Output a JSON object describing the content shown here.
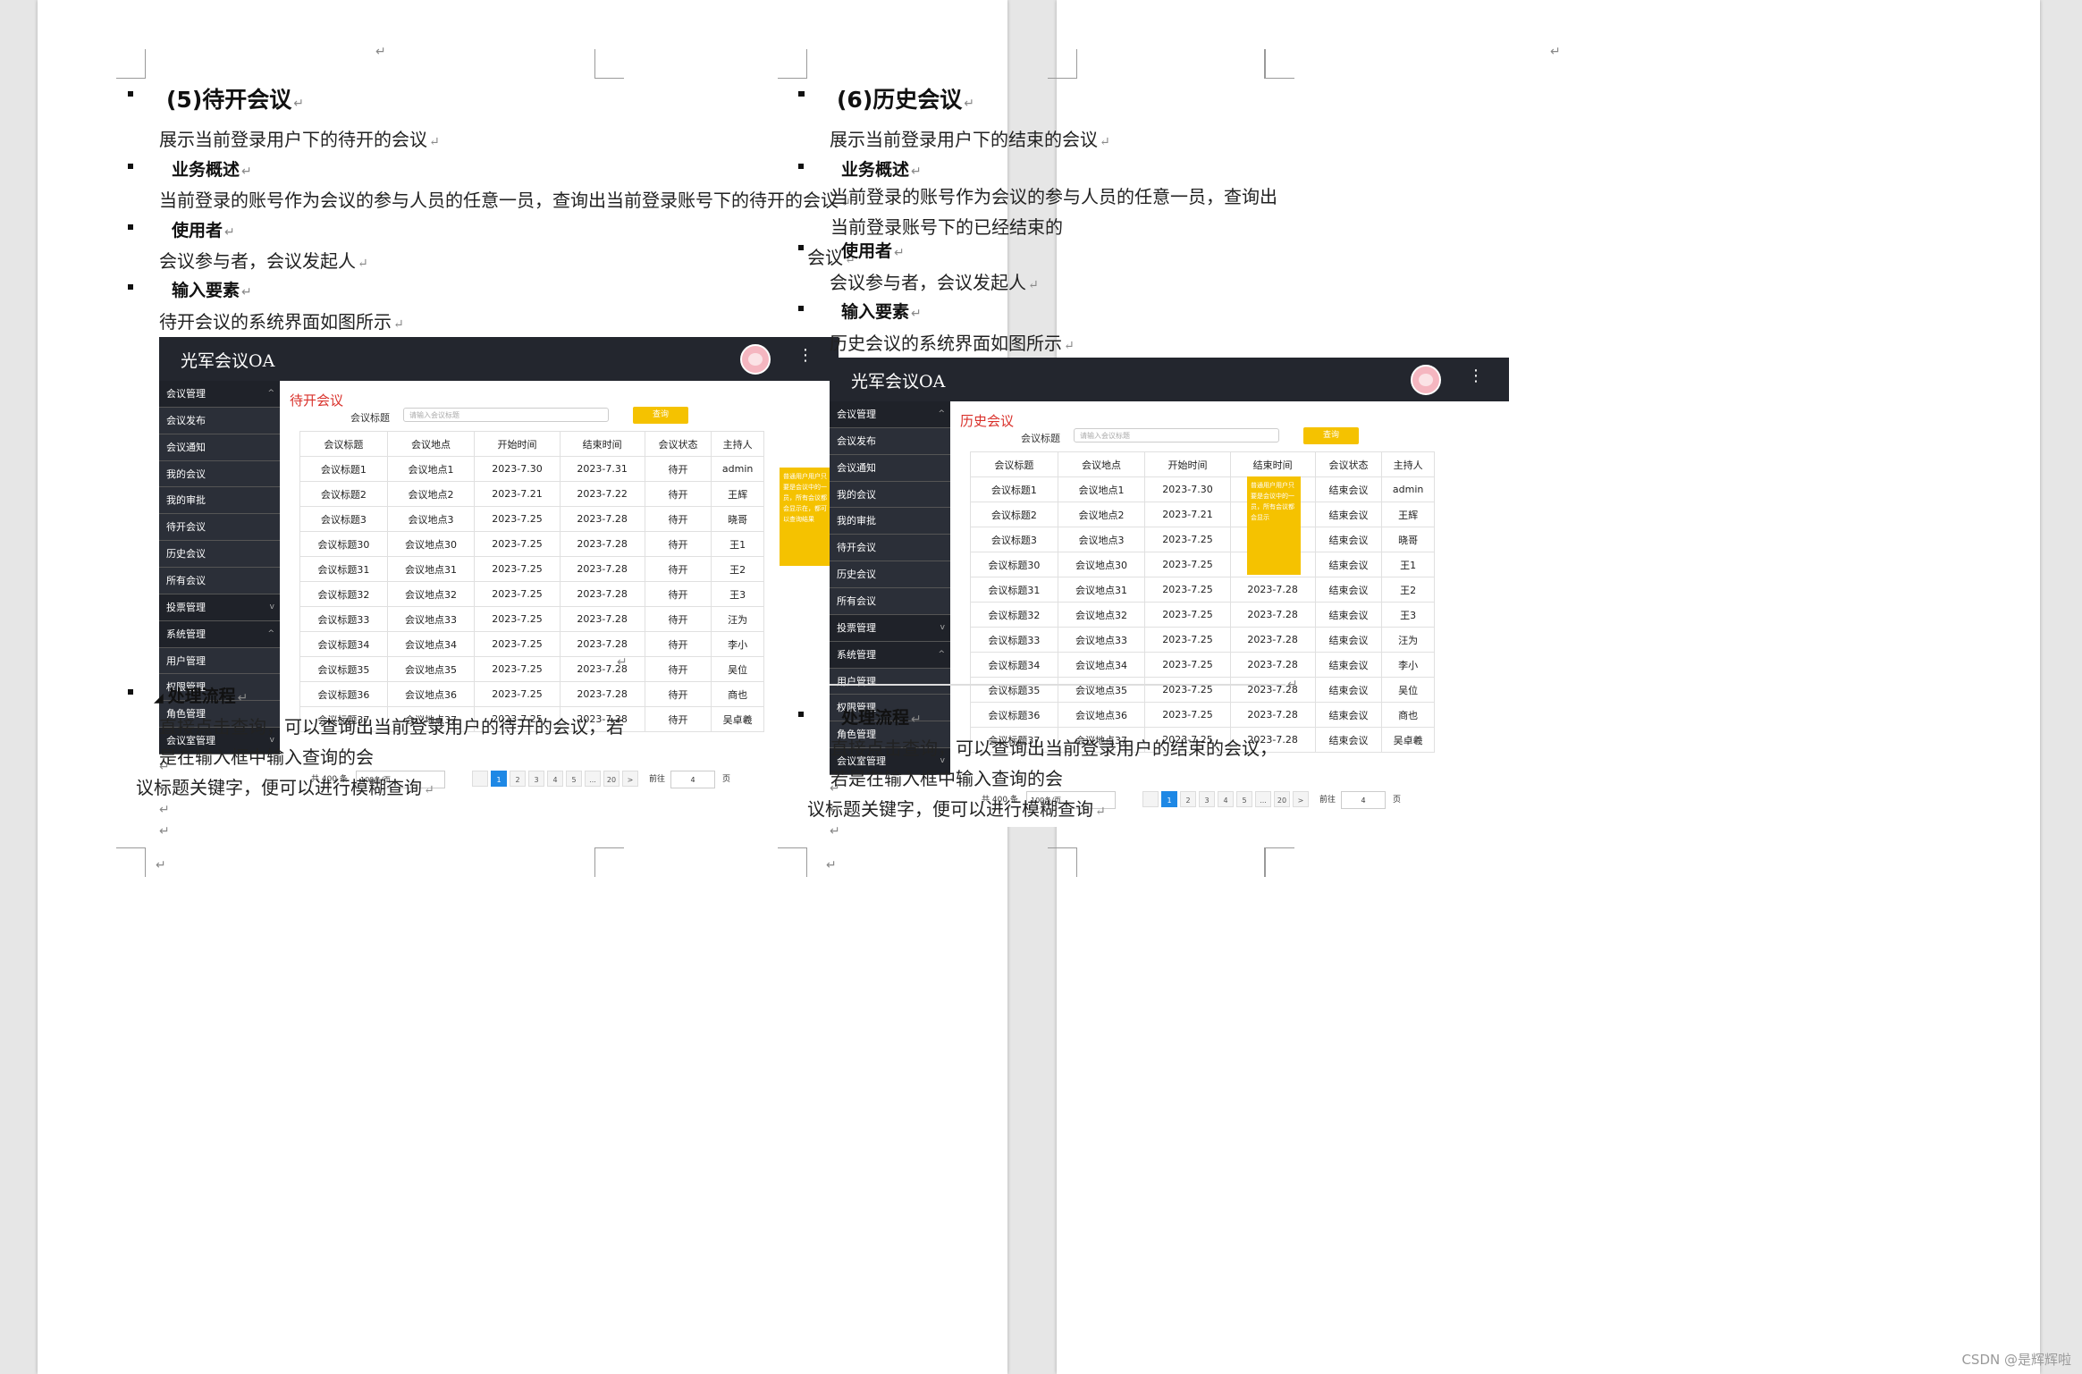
{
  "return_mark": "↵",
  "left_page": {
    "heading": "(5)待开会议",
    "intro": "展示当前登录用户下的待开的会议",
    "business_title": "业务概述",
    "business_text": "当前登录的账号作为会议的参与人员的任意一员，查询出当前登录账号下的待开的会议",
    "users_title": "使用者",
    "users_text": "会议参与者，会议发起人",
    "input_title": "输入要素",
    "input_text": "待开会议的系统界面如图所示",
    "flow_title": "处理流程",
    "flow_text_line1": "直接点击查询，可以查询出当前登录用户的待开的会议，若是在输入框中输入查询的会",
    "flow_text_line2": "议标题关键字，便可以进行模糊查询",
    "app": {
      "page_title": "待开会议",
      "notice": "普通用户用户只要是会议中的一员，所有会议都会显示在，都可以查询结果"
    },
    "status_value": "待开"
  },
  "right_page": {
    "heading": "(6)历史会议",
    "intro": "展示当前登录用户下的结束的会议",
    "business_title": "业务概述",
    "business_text_line1": "当前登录的账号作为会议的参与人员的任意一员，查询出当前登录账号下的已经结束的",
    "business_text_line2": "会议",
    "users_title": "使用者",
    "users_text": "会议参与者，会议发起人",
    "input_title": "输入要素",
    "input_text": "历史会议的系统界面如图所示",
    "flow_title": "处理流程",
    "flow_text_line1": "直接点击查询，可以查询出当前登录用户的结束的会议，若是在输入框中输入查询的会",
    "flow_text_line2": "议标题关键字，便可以进行模糊查询",
    "app": {
      "page_title": "历史会议",
      "notice": "普通用户用户只要是会议中的一员，所有会议都会显示"
    },
    "status_value": "结束会议"
  },
  "app_common": {
    "app_name": "光军会议OA",
    "kebab": "⋮",
    "sidebar": [
      {
        "label": "会议管理",
        "group": true,
        "chev": "^"
      },
      {
        "label": "会议发布"
      },
      {
        "label": "会议通知"
      },
      {
        "label": "我的会议"
      },
      {
        "label": "我的审批"
      },
      {
        "label": "待开会议"
      },
      {
        "label": "历史会议"
      },
      {
        "label": "所有会议"
      },
      {
        "label": "投票管理",
        "group": true,
        "chev": "v"
      },
      {
        "label": "系统管理",
        "group": true,
        "chev": "^"
      },
      {
        "label": "用户管理"
      },
      {
        "label": "权限管理"
      },
      {
        "label": "角色管理"
      },
      {
        "label": "会议室管理",
        "group": true,
        "chev": "v"
      }
    ],
    "search_label": "会议标题",
    "search_placeholder": "请输入会议标题",
    "search_button": "查询",
    "columns": [
      "会议标题",
      "会议地点",
      "开始时间",
      "结束时间",
      "会议状态",
      "主持人"
    ],
    "rows": [
      [
        "会议标题1",
        "会议地点1",
        "2023-7.30",
        "2023-7.31",
        "admin"
      ],
      [
        "会议标题2",
        "会议地点2",
        "2023-7.21",
        "2023-7.22",
        "王辉"
      ],
      [
        "会议标题3",
        "会议地点3",
        "2023-7.25",
        "2023-7.28",
        "晓哥"
      ],
      [
        "会议标题30",
        "会议地点30",
        "2023-7.25",
        "2023-7.28",
        "王1"
      ],
      [
        "会议标题31",
        "会议地点31",
        "2023-7.25",
        "2023-7.28",
        "王2"
      ],
      [
        "会议标题32",
        "会议地点32",
        "2023-7.25",
        "2023-7.28",
        "王3"
      ],
      [
        "会议标题33",
        "会议地点33",
        "2023-7.25",
        "2023-7.28",
        "汪为"
      ],
      [
        "会议标题34",
        "会议地点34",
        "2023-7.25",
        "2023-7.28",
        "李小"
      ],
      [
        "会议标题35",
        "会议地点35",
        "2023-7.25",
        "2023-7.28",
        "吴位"
      ],
      [
        "会议标题36",
        "会议地点36",
        "2023-7.25",
        "2023-7.28",
        "商也"
      ],
      [
        "会议标题37",
        "会议地点37",
        "2023-7.25",
        "2023-7.28",
        "吴卓羲"
      ]
    ],
    "pager": {
      "total": "共 400 条",
      "page_size": "100条/页",
      "pages": [
        "",
        "1",
        "2",
        "3",
        "4",
        "5",
        "...",
        "20",
        ">"
      ],
      "goto_label": "前往",
      "goto_value": "4",
      "goto_suffix": "页"
    }
  },
  "watermark": "CSDN @是辉辉啦"
}
